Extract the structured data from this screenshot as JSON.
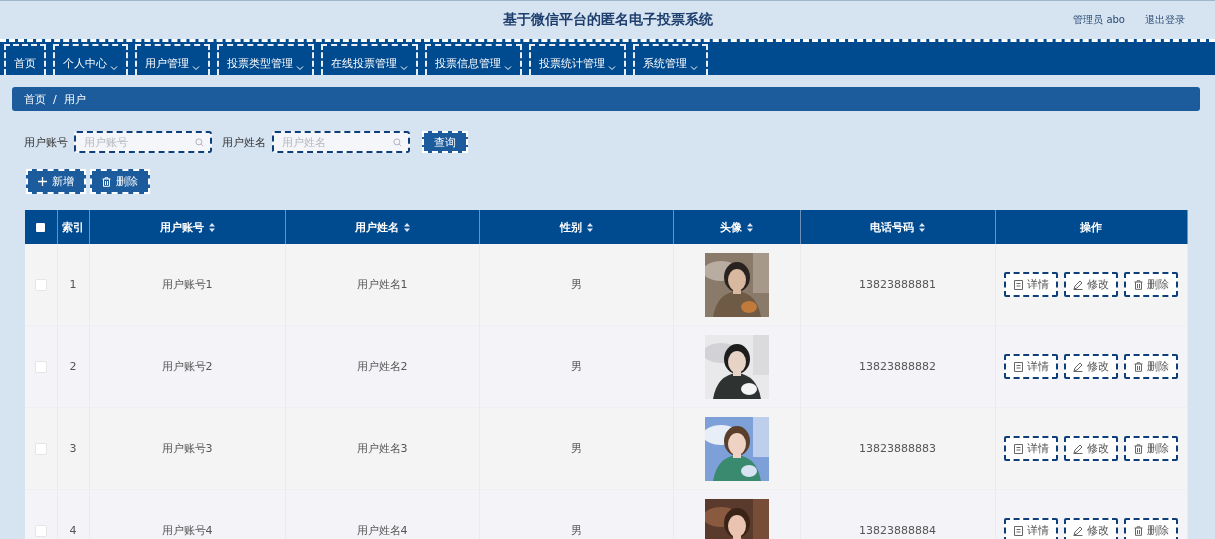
{
  "header": {
    "title": "基于微信平台的匿名电子投票系统",
    "user": "管理员 abo",
    "logout": "退出登录"
  },
  "nav": [
    {
      "label": "首页",
      "dropdown": false
    },
    {
      "label": "个人中心",
      "dropdown": true
    },
    {
      "label": "用户管理",
      "dropdown": true
    },
    {
      "label": "投票类型管理",
      "dropdown": true
    },
    {
      "label": "在线投票管理",
      "dropdown": true
    },
    {
      "label": "投票信息管理",
      "dropdown": true
    },
    {
      "label": "投票统计管理",
      "dropdown": true
    },
    {
      "label": "系统管理",
      "dropdown": true
    }
  ],
  "breadcrumb": {
    "items": [
      "首页",
      "用户"
    ],
    "separator": "/"
  },
  "search": {
    "fields": [
      {
        "label": "用户账号",
        "placeholder": "用户账号"
      },
      {
        "label": "用户姓名",
        "placeholder": "用户姓名"
      }
    ],
    "button": "查询"
  },
  "actions": [
    {
      "kind": "add",
      "label": "新增"
    },
    {
      "kind": "delete",
      "label": "删除"
    }
  ],
  "table": {
    "select_all": {
      "checked": false
    },
    "columns": [
      {
        "label": "索引",
        "sortable": false
      },
      {
        "label": "用户账号",
        "sortable": true
      },
      {
        "label": "用户姓名",
        "sortable": true
      },
      {
        "label": "性别",
        "sortable": true
      },
      {
        "label": "头像",
        "sortable": true
      },
      {
        "label": "电话号码",
        "sortable": true
      },
      {
        "label": "操作",
        "sortable": false
      }
    ],
    "rows": [
      {
        "checked": false,
        "index": "1",
        "account": "用户账号1",
        "name": "用户姓名1",
        "gender": "男",
        "avatar": {
          "kind": "picture"
        },
        "phone": "13823888881",
        "actions": [
          {
            "kind": "detail",
            "label": "详情"
          },
          {
            "kind": "edit",
            "label": "修改"
          },
          {
            "kind": "delete",
            "label": "删除"
          }
        ]
      },
      {
        "checked": false,
        "index": "2",
        "account": "用户账号2",
        "name": "用户姓名2",
        "gender": "男",
        "avatar": {
          "kind": "picture"
        },
        "phone": "13823888882",
        "actions": [
          {
            "kind": "detail",
            "label": "详情"
          },
          {
            "kind": "edit",
            "label": "修改"
          },
          {
            "kind": "delete",
            "label": "删除"
          }
        ]
      },
      {
        "checked": false,
        "index": "3",
        "account": "用户账号3",
        "name": "用户姓名3",
        "gender": "男",
        "avatar": {
          "kind": "picture"
        },
        "phone": "13823888883",
        "actions": [
          {
            "kind": "detail",
            "label": "详情"
          },
          {
            "kind": "edit",
            "label": "修改"
          },
          {
            "kind": "delete",
            "label": "删除"
          }
        ]
      },
      {
        "checked": false,
        "index": "4",
        "account": "用户账号4",
        "name": "用户姓名4",
        "gender": "男",
        "avatar": {
          "kind": "picture"
        },
        "phone": "13823888884",
        "actions": [
          {
            "kind": "detail",
            "label": "详情"
          },
          {
            "kind": "edit",
            "label": "修改"
          },
          {
            "kind": "delete",
            "label": "删除"
          }
        ]
      }
    ]
  }
}
